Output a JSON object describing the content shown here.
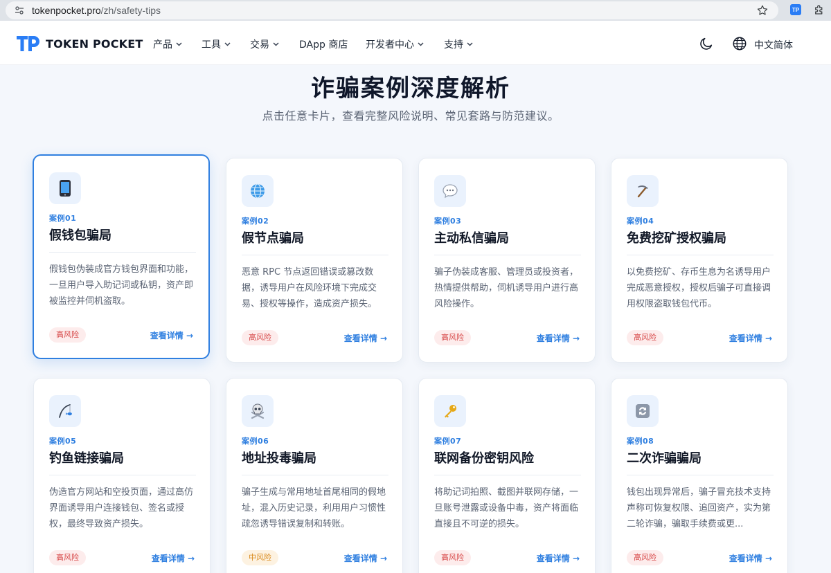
{
  "browser": {
    "url_host": "tokenpocket.pro",
    "url_path": "/zh/safety-tips"
  },
  "nav": {
    "brand": "TOKEN POCKET",
    "items": [
      "产品",
      "工具",
      "交易",
      "DApp 商店",
      "开发者中心",
      "支持"
    ],
    "language": "中文简体"
  },
  "hero": {
    "title": "诈骗案例深度解析",
    "subtitle": "点击任意卡片，查看完整风险说明、常见套路与防范建议。"
  },
  "cards": [
    {
      "case_no": "案例01",
      "title": "假钱包骗局",
      "desc": "假钱包伪装成官方钱包界面和功能，一旦用户导入助记词或私钥，资产即被监控并伺机盗取。",
      "risk": "高风险",
      "link": "查看详情 →",
      "icon": "mobile-phone-icon"
    },
    {
      "case_no": "案例02",
      "title": "假节点骗局",
      "desc": "恶意 RPC 节点返回错误或篡改数据，诱导用户在风险环境下完成交易、授权等操作，造成资产损失。",
      "risk": "高风险",
      "link": "查看详情 →",
      "icon": "globe-icon"
    },
    {
      "case_no": "案例03",
      "title": "主动私信骗局",
      "desc": "骗子伪装成客服、管理员或投资者，热情提供帮助，伺机诱导用户进行高风险操作。",
      "risk": "高风险",
      "link": "查看详情 →",
      "icon": "chat-bubble-icon"
    },
    {
      "case_no": "案例04",
      "title": "免费挖矿授权骗局",
      "desc": "以免费挖矿、存币生息为名诱导用户完成恶意授权，授权后骗子可直接调用权限盗取钱包代币。",
      "risk": "高风险",
      "link": "查看详情 →",
      "icon": "pickaxe-icon"
    },
    {
      "case_no": "案例05",
      "title": "钓鱼链接骗局",
      "desc": "伪造官方网站和空投页面，通过高仿界面诱导用户连接钱包、签名或授权，最终导致资产损失。",
      "risk": "高风险",
      "link": "查看详情 →",
      "icon": "fishing-pole-icon"
    },
    {
      "case_no": "案例06",
      "title": "地址投毒骗局",
      "desc": "骗子生成与常用地址首尾相同的假地址，混入历史记录，利用用户习惯性疏忽诱导错误复制和转账。",
      "risk": "中风险",
      "link": "查看详情 →",
      "icon": "skull-crossbones-icon"
    },
    {
      "case_no": "案例07",
      "title": "联网备份密钥风险",
      "desc": "将助记词拍照、截图并联网存储，一旦账号泄露或设备中毒，资产将面临直接且不可逆的损失。",
      "risk": "高风险",
      "link": "查看详情 →",
      "icon": "key-icon"
    },
    {
      "case_no": "案例08",
      "title": "二次诈骗骗局",
      "desc": "钱包出现异常后，骗子冒充技术支持声称可恢复权限、追回资产，实为第二轮诈骗，骗取手续费或更...",
      "risk": "高风险",
      "link": "查看详情 →",
      "icon": "refresh-icon"
    }
  ],
  "colors": {
    "accent": "#2f7fe0",
    "high_risk": "#d64545",
    "mid_risk": "#d98a1c",
    "page_bg": "#f4f7fc"
  }
}
